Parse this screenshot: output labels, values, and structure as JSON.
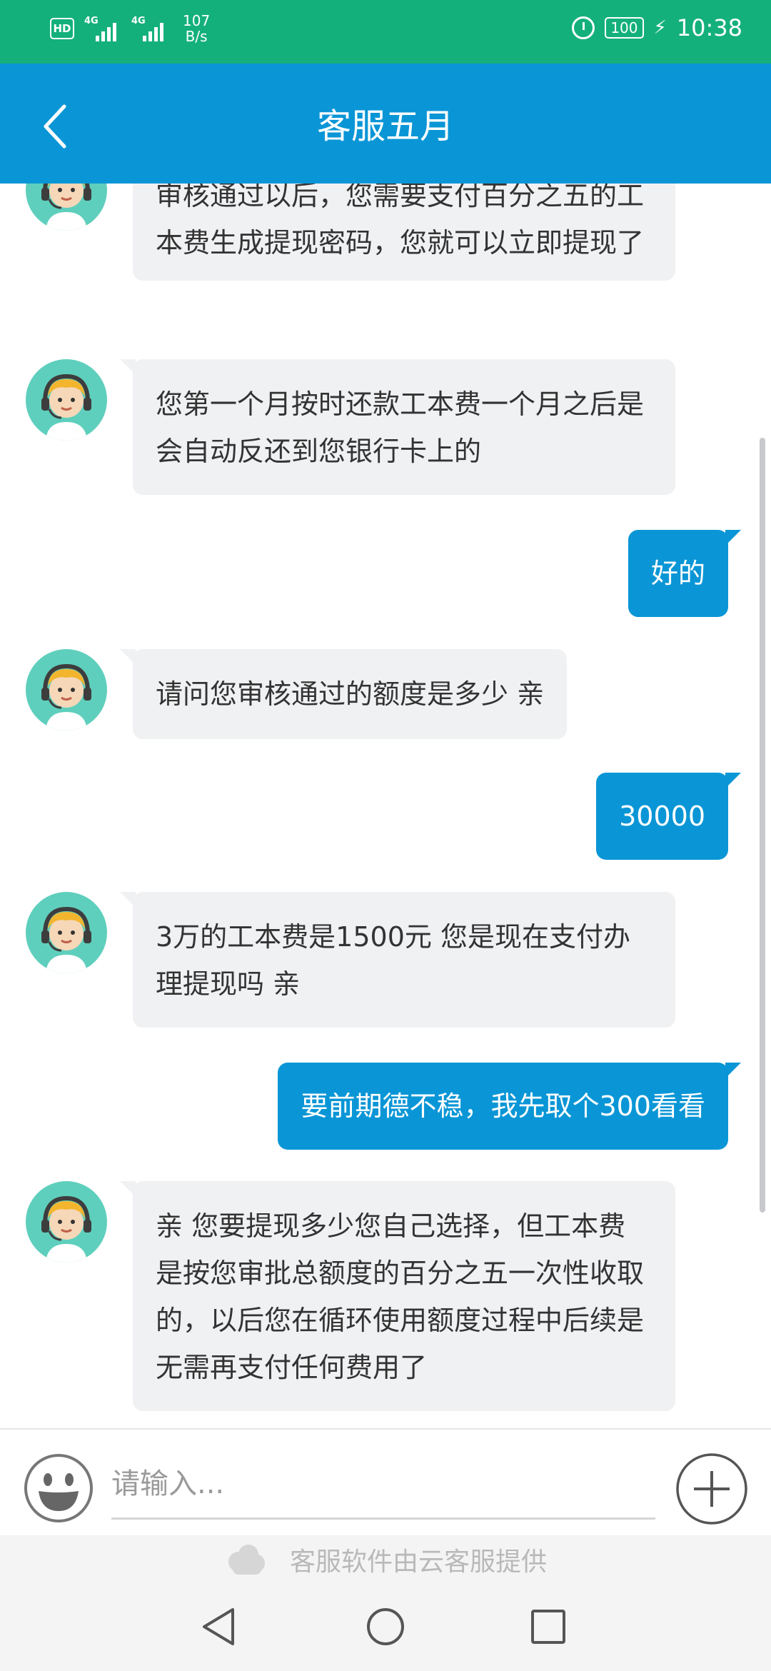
{
  "status_bar": {
    "hd": "HD",
    "signal1": "4G",
    "signal2": "4G",
    "speed_value": "107",
    "speed_unit": "B/s",
    "battery": "100",
    "time": "10:38"
  },
  "header": {
    "title": "客服五月"
  },
  "messages": [
    {
      "side": "in",
      "text": "审核通过以后，您需要支付百分之五的工本费生成提现密码，您就可以立即提现了"
    },
    {
      "side": "in",
      "text": "您第一个月按时还款工本费一个月之后是会自动反还到您银行卡上的"
    },
    {
      "side": "out",
      "text": "好的"
    },
    {
      "side": "in",
      "text": "请问您审核通过的额度是多少 亲"
    },
    {
      "side": "out",
      "text": "30000"
    },
    {
      "side": "in",
      "text": "3万的工本费是1500元 您是现在支付办理提现吗 亲"
    },
    {
      "side": "out",
      "text": "要前期德不稳，我先取个300看看"
    },
    {
      "side": "in",
      "text": "亲 您要提现多少您自己选择，但工本费是按您审批总额度的百分之五一次性收取的，以后您在循环使用额度过程中后续是无需再支付任何费用了"
    }
  ],
  "input": {
    "placeholder": "请输入..."
  },
  "footer": {
    "credit": "客服软件由云客服提供"
  },
  "icons": {
    "back": "back-arrow-icon",
    "emoji": "smiley-icon",
    "plus": "plus-icon",
    "nav_back": "nav-back-icon",
    "nav_home": "nav-home-icon",
    "nav_recent": "nav-recent-icon"
  },
  "colors": {
    "status_bar": "#14b07c",
    "header": "#0a96d6",
    "bubble_out": "#0a96d6",
    "bubble_in": "#f0f1f3"
  }
}
